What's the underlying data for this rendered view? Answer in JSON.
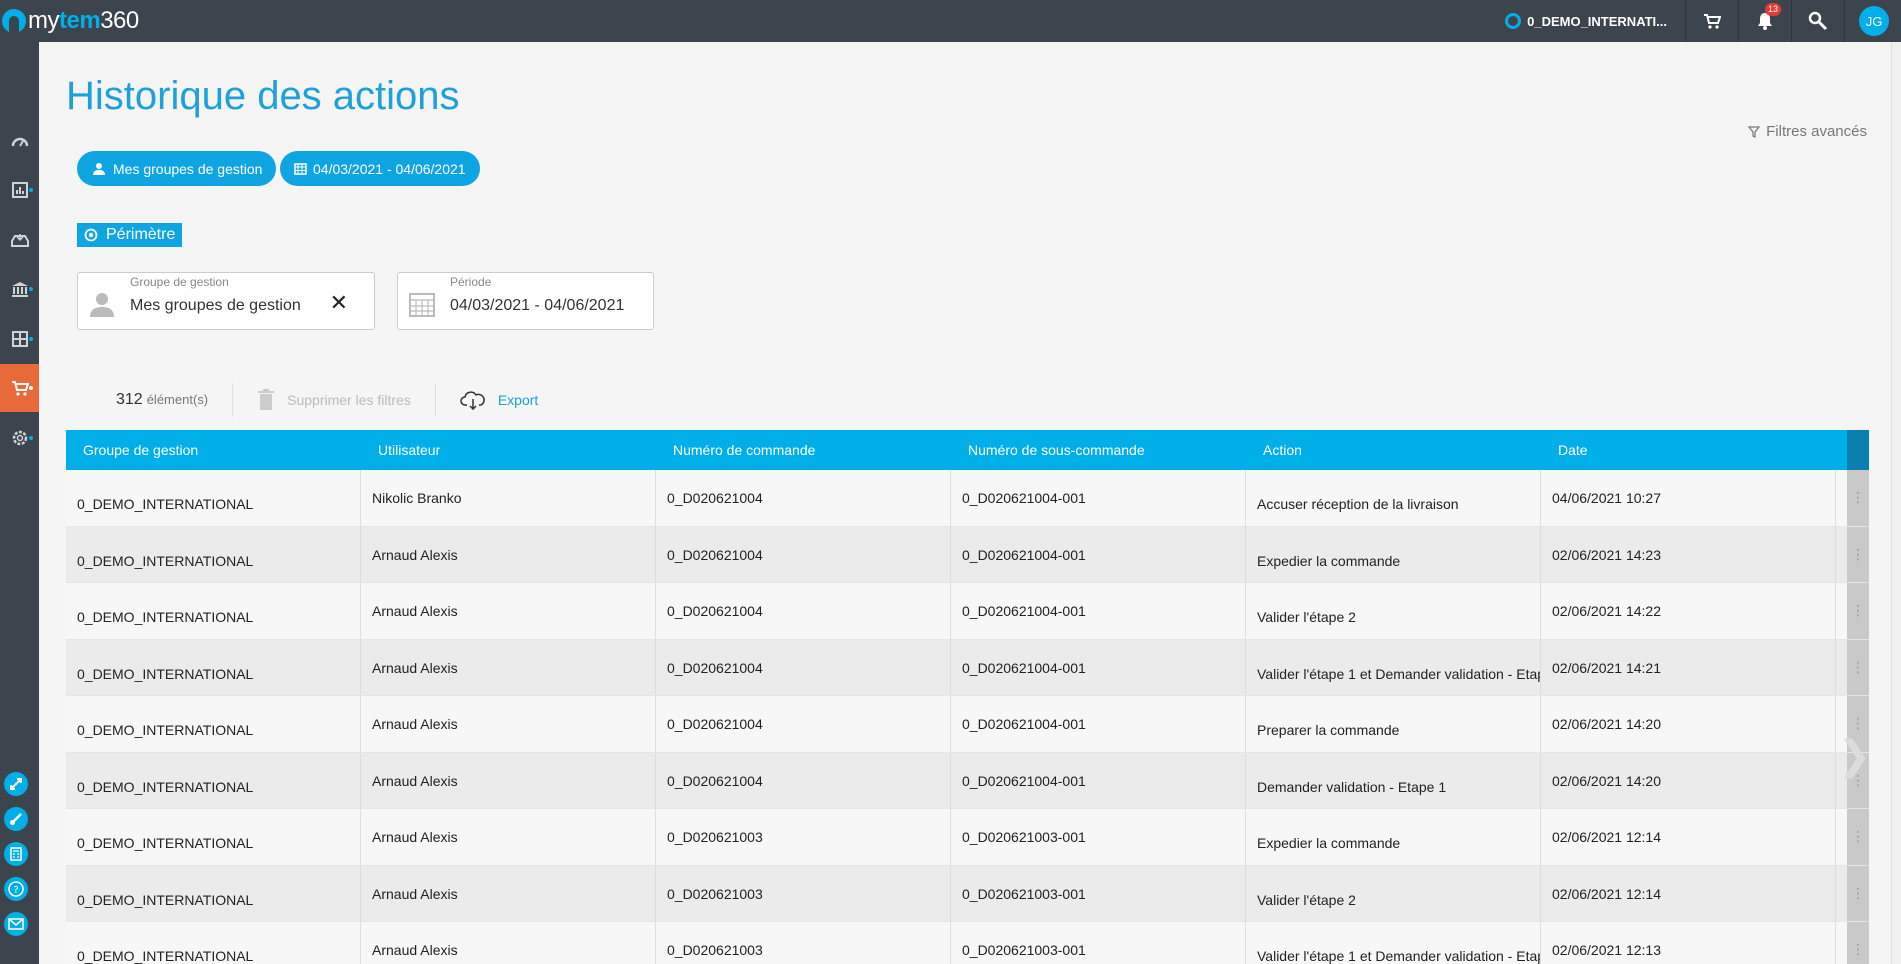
{
  "topbar": {
    "logo_prefix": "my",
    "logo_brand": "tem",
    "logo_suffix": "360",
    "org_name": "0_DEMO_INTERNATI...",
    "notifications_count": "13",
    "avatar_initials": "JG"
  },
  "page": {
    "title": "Historique des actions",
    "advanced_filters": "Filtres avancés"
  },
  "chips": {
    "groups": "Mes groupes de gestion",
    "period": "04/03/2021 - 04/06/2021"
  },
  "perimetre": {
    "label": "Périmètre"
  },
  "filters": {
    "group": {
      "label": "Groupe de gestion",
      "value": "Mes groupes de gestion"
    },
    "period": {
      "label": "Période",
      "value": "04/03/2021 - 04/06/2021"
    }
  },
  "toolbar": {
    "count": "312",
    "count_suffix": "élément(s)",
    "clear_filters": "Supprimer les filtres",
    "export": "Export"
  },
  "table": {
    "headers": [
      "Groupe de gestion",
      "Utilisateur",
      "Numéro de commande",
      "Numéro de sous-commande",
      "Action",
      "Date"
    ],
    "rows": [
      [
        "0_DEMO_INTERNATIONAL",
        "Nikolic Branko",
        "0_D020621004",
        "0_D020621004-001",
        "Accuser réception de la livraison",
        "04/06/2021 10:27"
      ],
      [
        "0_DEMO_INTERNATIONAL",
        "Arnaud Alexis",
        "0_D020621004",
        "0_D020621004-001",
        "Expedier la commande",
        "02/06/2021 14:23"
      ],
      [
        "0_DEMO_INTERNATIONAL",
        "Arnaud Alexis",
        "0_D020621004",
        "0_D020621004-001",
        "Valider l'étape 2",
        "02/06/2021 14:22"
      ],
      [
        "0_DEMO_INTERNATIONAL",
        "Arnaud Alexis",
        "0_D020621004",
        "0_D020621004-001",
        "Valider l'étape 1 et Demander validation - Etap",
        "02/06/2021 14:21"
      ],
      [
        "0_DEMO_INTERNATIONAL",
        "Arnaud Alexis",
        "0_D020621004",
        "0_D020621004-001",
        "Preparer la commande",
        "02/06/2021 14:20"
      ],
      [
        "0_DEMO_INTERNATIONAL",
        "Arnaud Alexis",
        "0_D020621004",
        "0_D020621004-001",
        "Demander validation - Etape 1",
        "02/06/2021 14:20"
      ],
      [
        "0_DEMO_INTERNATIONAL",
        "Arnaud Alexis",
        "0_D020621003",
        "0_D020621003-001",
        "Expedier la commande",
        "02/06/2021 12:14"
      ],
      [
        "0_DEMO_INTERNATIONAL",
        "Arnaud Alexis",
        "0_D020621003",
        "0_D020621003-001",
        "Valider l'étape 2",
        "02/06/2021 12:14"
      ],
      [
        "0_DEMO_INTERNATIONAL",
        "Arnaud Alexis",
        "0_D020621003",
        "0_D020621003-001",
        "Valider l'étape 1 et Demander validation - Etap",
        "02/06/2021 12:13"
      ]
    ]
  },
  "sidebar": {
    "items": [
      "dashboard-icon",
      "reports-icon",
      "inbox-icon",
      "bank-icon",
      "inventory-icon",
      "cart-icon",
      "settings-icon"
    ],
    "bottom": [
      "expand-icon",
      "brush-icon",
      "calculator-icon",
      "help-icon",
      "mail-icon"
    ]
  },
  "colors": {
    "accent": "#00aee8",
    "active": "#e8693a",
    "topbar": "#3c444d"
  }
}
